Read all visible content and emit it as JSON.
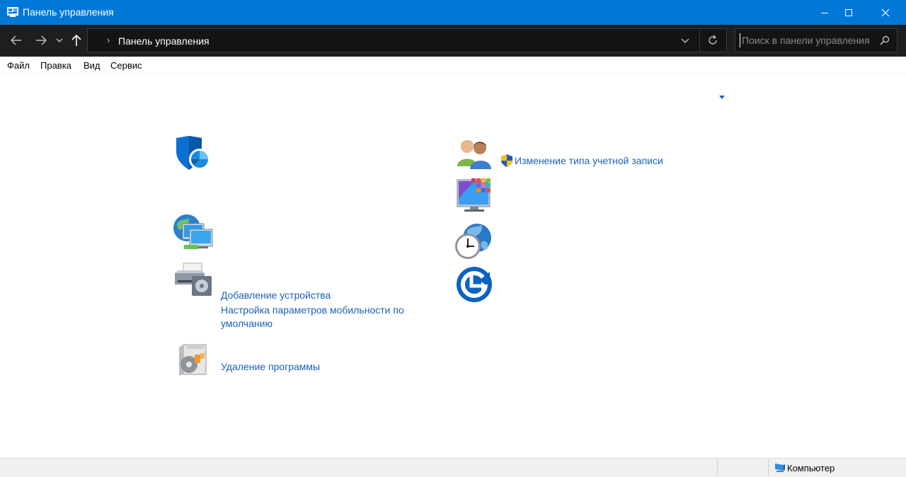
{
  "window": {
    "title": "Панель управления"
  },
  "address_bar": {
    "path": "Панель управления",
    "search_placeholder": "Поиск в панели управления"
  },
  "menu": {
    "items": [
      "Файл",
      "Правка",
      "Вид",
      "Сервис"
    ]
  },
  "content": {
    "links": {
      "change_account_type": "Изменение типа учетной записи",
      "add_device": "Добавление устройства",
      "mobility_settings": "Настройка параметров мобильности по умолчанию",
      "uninstall_program": "Удаление программы"
    }
  },
  "status_bar": {
    "computer_label": "Компьютер"
  },
  "colors": {
    "title_bar": "#0078d7",
    "address_bar": "#1e1e1e",
    "link": "#1a62b5"
  }
}
